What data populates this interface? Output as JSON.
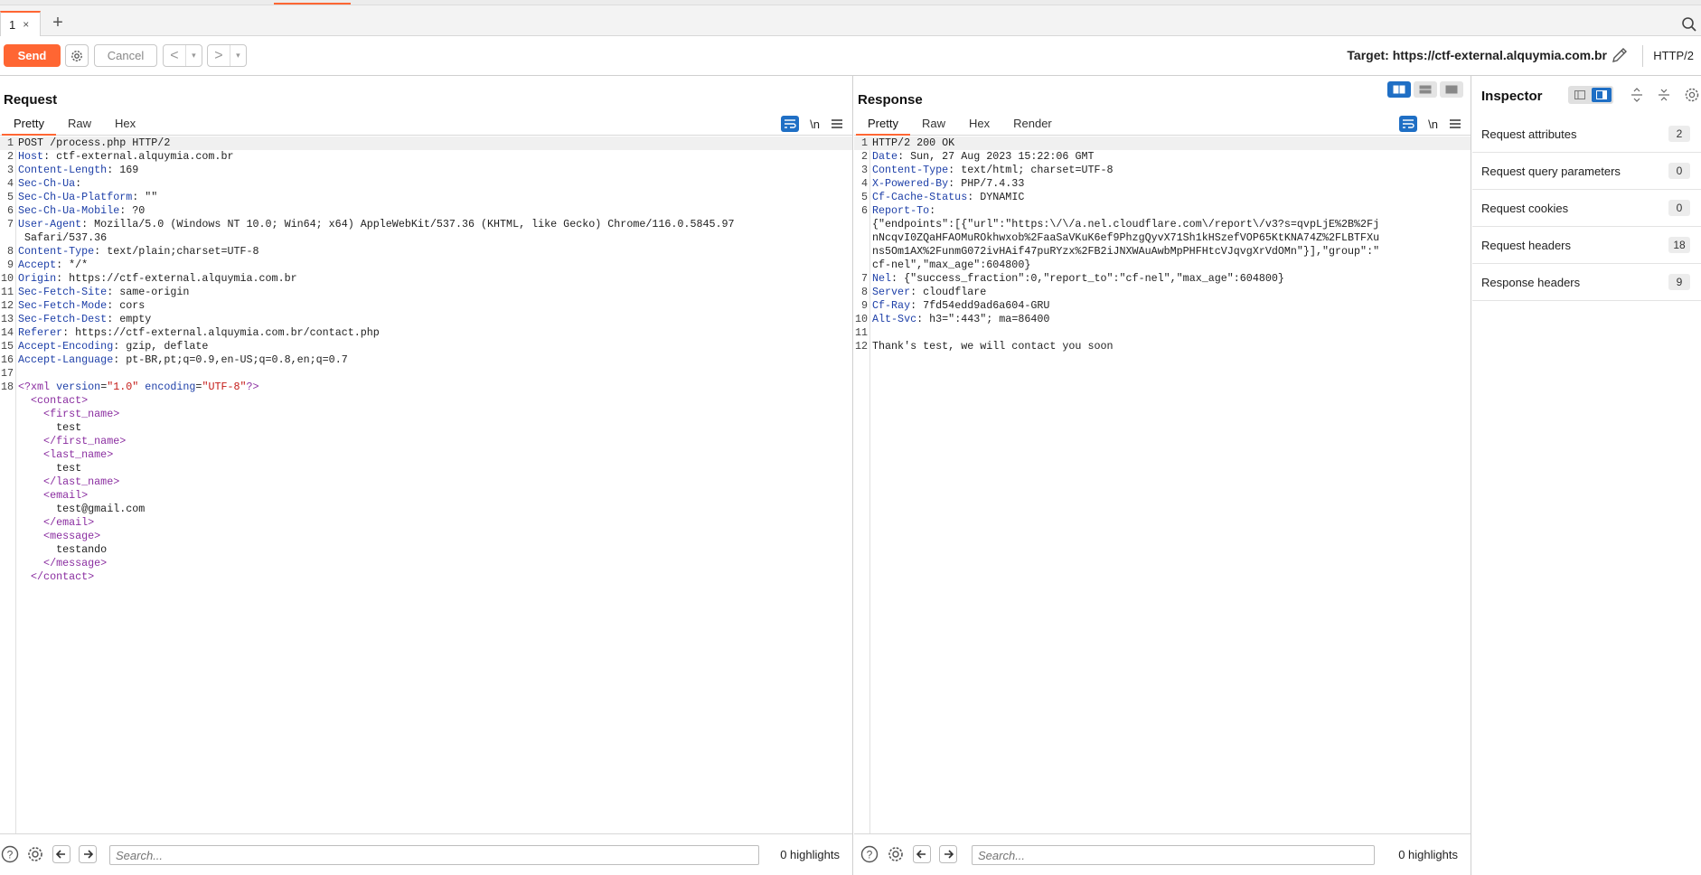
{
  "tabs": {
    "current_tab": "1",
    "close_glyph": "×",
    "add_glyph": "+"
  },
  "toolbar": {
    "send_label": "Send",
    "cancel_label": "Cancel",
    "back_glyph": "<",
    "forward_glyph": ">",
    "dropdown_glyph": "▾",
    "target_label": "Target: https://ctf-external.alquymia.com.br",
    "http_version": "HTTP/2"
  },
  "request": {
    "title": "Request",
    "tabs": [
      "Pretty",
      "Raw",
      "Hex"
    ],
    "newline_label": "\\n",
    "lines": [
      {
        "n": "1",
        "segs": [
          {
            "t": "POST /process.php HTTP/2",
            "c": ""
          }
        ]
      },
      {
        "n": "2",
        "segs": [
          {
            "t": "Host",
            "c": "hdrn"
          },
          {
            "t": ": ctf-external.alquymia.com.br",
            "c": ""
          }
        ]
      },
      {
        "n": "3",
        "segs": [
          {
            "t": "Content-Length",
            "c": "hdrn"
          },
          {
            "t": ": 169",
            "c": ""
          }
        ]
      },
      {
        "n": "4",
        "segs": [
          {
            "t": "Sec-Ch-Ua",
            "c": "hdrn"
          },
          {
            "t": ":",
            "c": ""
          }
        ]
      },
      {
        "n": "5",
        "segs": [
          {
            "t": "Sec-Ch-Ua-Platform",
            "c": "hdrn"
          },
          {
            "t": ": \"\"",
            "c": ""
          }
        ]
      },
      {
        "n": "6",
        "segs": [
          {
            "t": "Sec-Ch-Ua-Mobile",
            "c": "hdrn"
          },
          {
            "t": ": ?0",
            "c": ""
          }
        ]
      },
      {
        "n": "7",
        "segs": [
          {
            "t": "User-Agent",
            "c": "hdrn"
          },
          {
            "t": ": Mozilla/5.0 (Windows NT 10.0; Win64; x64) AppleWebKit/537.36 (KHTML, like Gecko) Chrome/116.0.5845.97",
            "c": ""
          }
        ]
      },
      {
        "n": "",
        "segs": [
          {
            "t": " Safari/537.36",
            "c": ""
          }
        ]
      },
      {
        "n": "8",
        "segs": [
          {
            "t": "Content-Type",
            "c": "hdrn"
          },
          {
            "t": ": text/plain;charset=UTF-8",
            "c": ""
          }
        ]
      },
      {
        "n": "9",
        "segs": [
          {
            "t": "Accept",
            "c": "hdrn"
          },
          {
            "t": ": */*",
            "c": ""
          }
        ]
      },
      {
        "n": "10",
        "segs": [
          {
            "t": "Origin",
            "c": "hdrn"
          },
          {
            "t": ": https://ctf-external.alquymia.com.br",
            "c": ""
          }
        ]
      },
      {
        "n": "11",
        "segs": [
          {
            "t": "Sec-Fetch-Site",
            "c": "hdrn"
          },
          {
            "t": ": same-origin",
            "c": ""
          }
        ]
      },
      {
        "n": "12",
        "segs": [
          {
            "t": "Sec-Fetch-Mode",
            "c": "hdrn"
          },
          {
            "t": ": cors",
            "c": ""
          }
        ]
      },
      {
        "n": "13",
        "segs": [
          {
            "t": "Sec-Fetch-Dest",
            "c": "hdrn"
          },
          {
            "t": ": empty",
            "c": ""
          }
        ]
      },
      {
        "n": "14",
        "segs": [
          {
            "t": "Referer",
            "c": "hdrn"
          },
          {
            "t": ": https://ctf-external.alquymia.com.br/contact.php",
            "c": ""
          }
        ]
      },
      {
        "n": "15",
        "segs": [
          {
            "t": "Accept-Encoding",
            "c": "hdrn"
          },
          {
            "t": ": gzip, deflate",
            "c": ""
          }
        ]
      },
      {
        "n": "16",
        "segs": [
          {
            "t": "Accept-Language",
            "c": "hdrn"
          },
          {
            "t": ": pt-BR,pt;q=0.9,en-US;q=0.8,en;q=0.7",
            "c": ""
          }
        ]
      },
      {
        "n": "17",
        "segs": [
          {
            "t": "",
            "c": ""
          }
        ]
      },
      {
        "n": "18",
        "segs": [
          {
            "t": "<?xml ",
            "c": "tag"
          },
          {
            "t": "version",
            "c": "attr"
          },
          {
            "t": "=",
            "c": ""
          },
          {
            "t": "\"1.0\"",
            "c": "str"
          },
          {
            "t": " encoding",
            "c": "attr"
          },
          {
            "t": "=",
            "c": ""
          },
          {
            "t": "\"UTF-8\"",
            "c": "str"
          },
          {
            "t": "?>",
            "c": "tag"
          }
        ]
      },
      {
        "n": "",
        "segs": [
          {
            "t": "  <contact>",
            "c": "tag"
          }
        ]
      },
      {
        "n": "",
        "segs": [
          {
            "t": "    <first_name>",
            "c": "tag"
          }
        ]
      },
      {
        "n": "",
        "segs": [
          {
            "t": "      test",
            "c": ""
          }
        ]
      },
      {
        "n": "",
        "segs": [
          {
            "t": "    </first_name>",
            "c": "tag"
          }
        ]
      },
      {
        "n": "",
        "segs": [
          {
            "t": "    <last_name>",
            "c": "tag"
          }
        ]
      },
      {
        "n": "",
        "segs": [
          {
            "t": "      test",
            "c": ""
          }
        ]
      },
      {
        "n": "",
        "segs": [
          {
            "t": "    </last_name>",
            "c": "tag"
          }
        ]
      },
      {
        "n": "",
        "segs": [
          {
            "t": "    <email>",
            "c": "tag"
          }
        ]
      },
      {
        "n": "",
        "segs": [
          {
            "t": "      test@gmail.com",
            "c": ""
          }
        ]
      },
      {
        "n": "",
        "segs": [
          {
            "t": "    </email>",
            "c": "tag"
          }
        ]
      },
      {
        "n": "",
        "segs": [
          {
            "t": "    <message>",
            "c": "tag"
          }
        ]
      },
      {
        "n": "",
        "segs": [
          {
            "t": "      testando",
            "c": ""
          }
        ]
      },
      {
        "n": "",
        "segs": [
          {
            "t": "    </message>",
            "c": "tag"
          }
        ]
      },
      {
        "n": "",
        "segs": [
          {
            "t": "  </contact>",
            "c": "tag"
          }
        ]
      }
    ],
    "search_placeholder": "Search...",
    "highlights": "0 highlights"
  },
  "response": {
    "title": "Response",
    "tabs": [
      "Pretty",
      "Raw",
      "Hex",
      "Render"
    ],
    "newline_label": "\\n",
    "lines": [
      {
        "n": "1",
        "segs": [
          {
            "t": "HTTP/2 200 OK",
            "c": ""
          }
        ]
      },
      {
        "n": "2",
        "segs": [
          {
            "t": "Date",
            "c": "hdrn"
          },
          {
            "t": ": Sun, 27 Aug 2023 15:22:06 GMT",
            "c": ""
          }
        ]
      },
      {
        "n": "3",
        "segs": [
          {
            "t": "Content-Type",
            "c": "hdrn"
          },
          {
            "t": ": text/html; charset=UTF-8",
            "c": ""
          }
        ]
      },
      {
        "n": "4",
        "segs": [
          {
            "t": "X-Powered-By",
            "c": "hdrn"
          },
          {
            "t": ": PHP/7.4.33",
            "c": ""
          }
        ]
      },
      {
        "n": "5",
        "segs": [
          {
            "t": "Cf-Cache-Status",
            "c": "hdrn"
          },
          {
            "t": ": DYNAMIC",
            "c": ""
          }
        ]
      },
      {
        "n": "6",
        "segs": [
          {
            "t": "Report-To",
            "c": "hdrn"
          },
          {
            "t": ":",
            "c": ""
          }
        ]
      },
      {
        "n": "",
        "segs": [
          {
            "t": "{\"endpoints\":[{\"url\":\"https:\\/\\/a.nel.cloudflare.com\\/report\\/v3?s=qvpLjE%2B%2Fj",
            "c": ""
          }
        ]
      },
      {
        "n": "",
        "segs": [
          {
            "t": "nNcqvI0ZQaHFAOMuROkhwxob%2FaaSaVKuK6ef9PhzgQyvX71Sh1kHSzefVOP65KtKNA74Z%2FLBTFXu",
            "c": ""
          }
        ]
      },
      {
        "n": "",
        "segs": [
          {
            "t": "ns5Om1AX%2FunmG072ivHAif47puRYzx%2FB2iJNXWAuAwbMpPHFHtcVJqvgXrVdOMn\"}],\"group\":\"",
            "c": ""
          }
        ]
      },
      {
        "n": "",
        "segs": [
          {
            "t": "cf-nel\",\"max_age\":604800}",
            "c": ""
          }
        ]
      },
      {
        "n": "7",
        "segs": [
          {
            "t": "Nel",
            "c": "hdrn"
          },
          {
            "t": ": {\"success_fraction\":0,\"report_to\":\"cf-nel\",\"max_age\":604800}",
            "c": ""
          }
        ]
      },
      {
        "n": "8",
        "segs": [
          {
            "t": "Server",
            "c": "hdrn"
          },
          {
            "t": ": cloudflare",
            "c": ""
          }
        ]
      },
      {
        "n": "9",
        "segs": [
          {
            "t": "Cf-Ray",
            "c": "hdrn"
          },
          {
            "t": ": 7fd54edd9ad6a604-GRU",
            "c": ""
          }
        ]
      },
      {
        "n": "10",
        "segs": [
          {
            "t": "Alt-Svc",
            "c": "hdrn"
          },
          {
            "t": ": h3=\":443\"; ma=86400",
            "c": ""
          }
        ]
      },
      {
        "n": "11",
        "segs": [
          {
            "t": "",
            "c": ""
          }
        ]
      },
      {
        "n": "12",
        "segs": [
          {
            "t": "Thank's test, we will contact you soon",
            "c": ""
          }
        ]
      }
    ],
    "search_placeholder": "Search...",
    "highlights": "0 highlights"
  },
  "inspector": {
    "title": "Inspector",
    "rows": [
      {
        "label": "Request attributes",
        "count": "2"
      },
      {
        "label": "Request query parameters",
        "count": "0"
      },
      {
        "label": "Request cookies",
        "count": "0"
      },
      {
        "label": "Request headers",
        "count": "18"
      },
      {
        "label": "Response headers",
        "count": "9"
      }
    ]
  },
  "colors": {
    "accent": "#ff6633",
    "primary_blue": "#1f6fc5",
    "header_name": "#1d3fa8",
    "xml_tag": "#8a2da0",
    "xml_string": "#c41a16"
  }
}
